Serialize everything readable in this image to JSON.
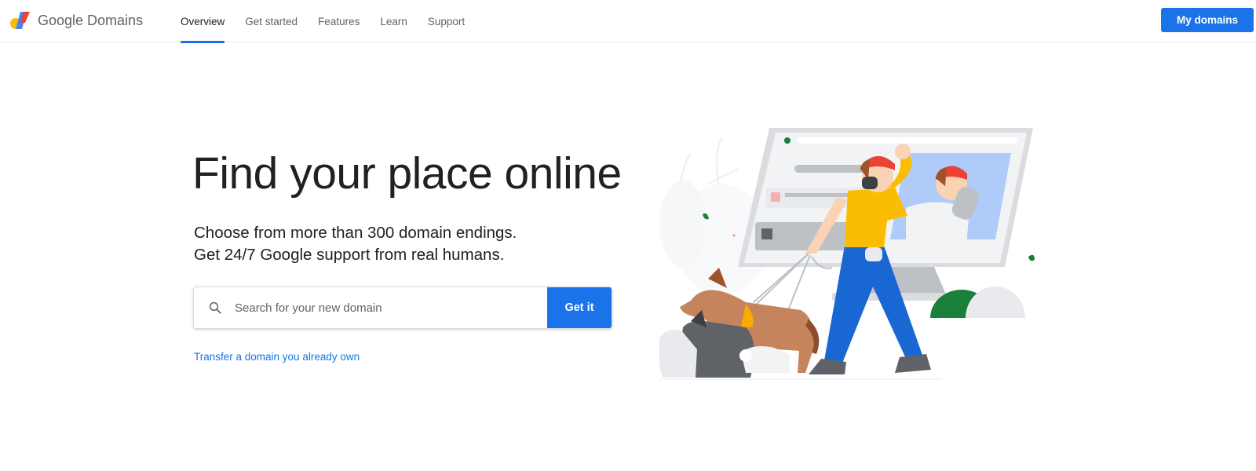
{
  "header": {
    "logo_text": "Google Domains",
    "nav": [
      {
        "label": "Overview",
        "active": true
      },
      {
        "label": "Get started",
        "active": false
      },
      {
        "label": "Features",
        "active": false
      },
      {
        "label": "Learn",
        "active": false
      },
      {
        "label": "Support",
        "active": false
      }
    ],
    "my_domains_label": "My domains"
  },
  "hero": {
    "title": "Find your place online",
    "subtitle_line1": "Choose from more than 300 domain endings.",
    "subtitle_line2": "Get 24/7 Google support from real humans."
  },
  "search": {
    "placeholder": "Search for your new domain",
    "value": "",
    "button_label": "Get it"
  },
  "transfer_link": "Transfer a domain you already own",
  "colors": {
    "accent": "#1a73e8",
    "text": "#202124",
    "muted": "#5f6368"
  }
}
